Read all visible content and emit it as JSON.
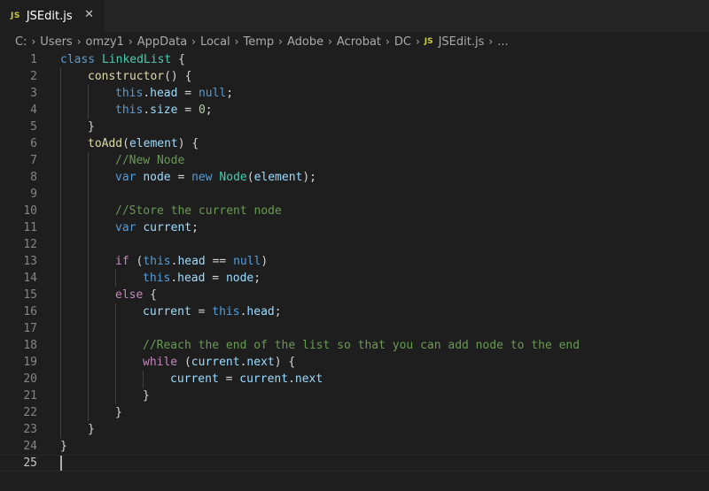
{
  "tab": {
    "icon": "JS",
    "label": "JSEdit.js",
    "close": "✕"
  },
  "breadcrumb": {
    "items": [
      "C:",
      "Users",
      "omzy1",
      "AppData",
      "Local",
      "Temp",
      "Adobe",
      "Acrobat",
      "DC"
    ],
    "file_icon": "JS",
    "file": "JSEdit.js",
    "ellipsis": "..."
  },
  "editor": {
    "current_line": 25,
    "lines": [
      {
        "n": "1",
        "indent": 0,
        "tokens": [
          [
            "kw",
            "class"
          ],
          [
            "pn",
            " "
          ],
          [
            "cls",
            "LinkedList"
          ],
          [
            "pn",
            " {"
          ]
        ]
      },
      {
        "n": "2",
        "indent": 1,
        "tokens": [
          [
            "fn",
            "constructor"
          ],
          [
            "pn",
            "() {"
          ]
        ]
      },
      {
        "n": "3",
        "indent": 2,
        "tokens": [
          [
            "kw",
            "this"
          ],
          [
            "pn",
            "."
          ],
          [
            "vr",
            "head"
          ],
          [
            "pn",
            " = "
          ],
          [
            "kw",
            "null"
          ],
          [
            "pn",
            ";"
          ]
        ]
      },
      {
        "n": "4",
        "indent": 2,
        "tokens": [
          [
            "kw",
            "this"
          ],
          [
            "pn",
            "."
          ],
          [
            "vr",
            "size"
          ],
          [
            "pn",
            " = "
          ],
          [
            "num",
            "0"
          ],
          [
            "pn",
            ";"
          ]
        ]
      },
      {
        "n": "5",
        "indent": 1,
        "tokens": [
          [
            "pn",
            "}"
          ]
        ]
      },
      {
        "n": "6",
        "indent": 1,
        "tokens": [
          [
            "fn",
            "toAdd"
          ],
          [
            "pn",
            "("
          ],
          [
            "vr",
            "element"
          ],
          [
            "pn",
            ") {"
          ]
        ]
      },
      {
        "n": "7",
        "indent": 2,
        "tokens": [
          [
            "cm",
            "//New Node"
          ]
        ]
      },
      {
        "n": "8",
        "indent": 2,
        "tokens": [
          [
            "kw",
            "var"
          ],
          [
            "pn",
            " "
          ],
          [
            "vr",
            "node"
          ],
          [
            "pn",
            " = "
          ],
          [
            "kw",
            "new"
          ],
          [
            "pn",
            " "
          ],
          [
            "cls",
            "Node"
          ],
          [
            "pn",
            "("
          ],
          [
            "vr",
            "element"
          ],
          [
            "pn",
            ");"
          ]
        ]
      },
      {
        "n": "9",
        "indent": 2,
        "tokens": []
      },
      {
        "n": "10",
        "indent": 2,
        "tokens": [
          [
            "cm",
            "//Store the current node"
          ]
        ]
      },
      {
        "n": "11",
        "indent": 2,
        "tokens": [
          [
            "kw",
            "var"
          ],
          [
            "pn",
            " "
          ],
          [
            "vr",
            "current"
          ],
          [
            "pn",
            ";"
          ]
        ]
      },
      {
        "n": "12",
        "indent": 2,
        "tokens": []
      },
      {
        "n": "13",
        "indent": 2,
        "tokens": [
          [
            "ctl",
            "if"
          ],
          [
            "pn",
            " ("
          ],
          [
            "kw",
            "this"
          ],
          [
            "pn",
            "."
          ],
          [
            "vr",
            "head"
          ],
          [
            "pn",
            " == "
          ],
          [
            "kw",
            "null"
          ],
          [
            "pn",
            ")"
          ]
        ]
      },
      {
        "n": "14",
        "indent": 3,
        "tokens": [
          [
            "kw",
            "this"
          ],
          [
            "pn",
            "."
          ],
          [
            "vr",
            "head"
          ],
          [
            "pn",
            " = "
          ],
          [
            "vr",
            "node"
          ],
          [
            "pn",
            ";"
          ]
        ]
      },
      {
        "n": "15",
        "indent": 2,
        "tokens": [
          [
            "ctl",
            "else"
          ],
          [
            "pn",
            " {"
          ]
        ]
      },
      {
        "n": "16",
        "indent": 3,
        "tokens": [
          [
            "vr",
            "current"
          ],
          [
            "pn",
            " = "
          ],
          [
            "kw",
            "this"
          ],
          [
            "pn",
            "."
          ],
          [
            "vr",
            "head"
          ],
          [
            "pn",
            ";"
          ]
        ]
      },
      {
        "n": "17",
        "indent": 3,
        "tokens": []
      },
      {
        "n": "18",
        "indent": 3,
        "tokens": [
          [
            "cm",
            "//Reach the end of the list so that you can add node to the end"
          ]
        ]
      },
      {
        "n": "19",
        "indent": 3,
        "tokens": [
          [
            "ctl",
            "while"
          ],
          [
            "pn",
            " ("
          ],
          [
            "vr",
            "current"
          ],
          [
            "pn",
            "."
          ],
          [
            "vr",
            "next"
          ],
          [
            "pn",
            ") {"
          ]
        ]
      },
      {
        "n": "20",
        "indent": 4,
        "tokens": [
          [
            "vr",
            "current"
          ],
          [
            "pn",
            " = "
          ],
          [
            "vr",
            "current"
          ],
          [
            "pn",
            "."
          ],
          [
            "vr",
            "next"
          ]
        ]
      },
      {
        "n": "21",
        "indent": 3,
        "tokens": [
          [
            "pn",
            "}"
          ]
        ]
      },
      {
        "n": "22",
        "indent": 2,
        "tokens": [
          [
            "pn",
            "}"
          ]
        ]
      },
      {
        "n": "23",
        "indent": 1,
        "tokens": [
          [
            "pn",
            "}"
          ]
        ]
      },
      {
        "n": "24",
        "indent": 0,
        "tokens": [
          [
            "pn",
            "}"
          ]
        ]
      },
      {
        "n": "25",
        "indent": 0,
        "tokens": []
      }
    ]
  }
}
